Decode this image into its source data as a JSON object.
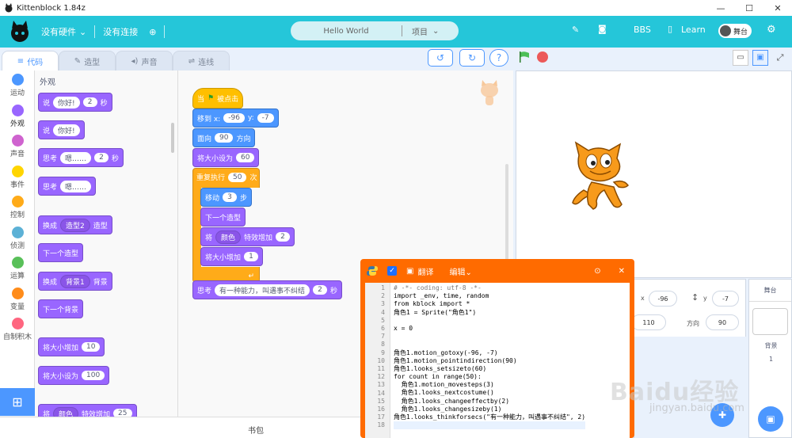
{
  "titlebar": {
    "title": "Kittenblock 1.84z"
  },
  "menubar": {
    "hardware": "没有硬件",
    "connection": "没有连接",
    "project_name": "Hello World",
    "project_menu": "项目",
    "bbs": "BBS",
    "learn": "Learn",
    "stage_toggle": "舞台"
  },
  "tabs": [
    {
      "label": "代码"
    },
    {
      "label": "造型"
    },
    {
      "label": "声音"
    },
    {
      "label": "连线"
    }
  ],
  "categories": [
    {
      "label": "运动",
      "color": "#4c97ff"
    },
    {
      "label": "外观",
      "color": "#9966ff"
    },
    {
      "label": "声音",
      "color": "#cf63cf"
    },
    {
      "label": "事件",
      "color": "#ffd500"
    },
    {
      "label": "控制",
      "color": "#ffab19"
    },
    {
      "label": "侦测",
      "color": "#5cb1d6"
    },
    {
      "label": "运算",
      "color": "#59c059"
    },
    {
      "label": "变量",
      "color": "#ff8c1a"
    },
    {
      "label": "自制积木",
      "color": "#ff6680"
    }
  ],
  "palette": {
    "heading": "外观",
    "say_secs": {
      "verb": "说",
      "text": "你好!",
      "secs": "2",
      "unit": "秒"
    },
    "say": {
      "verb": "说",
      "text": "你好!"
    },
    "think_secs": {
      "verb": "思考",
      "text": "嗯……",
      "secs": "2",
      "unit": "秒"
    },
    "think": {
      "verb": "思考",
      "text": "嗯……"
    },
    "switch_costume": {
      "verb": "换成",
      "value": "造型2",
      "suffix": "造型"
    },
    "next_costume": "下一个造型",
    "switch_backdrop": {
      "verb": "换成",
      "value": "背景1",
      "suffix": "背景"
    },
    "next_backdrop": "下一个背景",
    "change_size": {
      "verb": "将大小增加",
      "value": "10"
    },
    "set_size": {
      "verb": "将大小设为",
      "value": "100"
    },
    "change_effect": {
      "verb": "将",
      "value": "颜色",
      "suffix": "特效增加",
      "num": "25"
    }
  },
  "script": {
    "hat": {
      "prefix": "当",
      "suffix": "被点击"
    },
    "goto": {
      "label": "移到 x:",
      "x": "-96",
      "ylabel": "y:",
      "y": "-7"
    },
    "point": {
      "label": "面向",
      "value": "90",
      "suffix": "方向"
    },
    "setsize": {
      "label": "将大小设为",
      "value": "60"
    },
    "repeat": {
      "label": "重复执行",
      "value": "50",
      "suffix": "次"
    },
    "move": {
      "label": "移动",
      "value": "3",
      "suffix": "步"
    },
    "next_costume": "下一个造型",
    "effect": {
      "label": "将",
      "value": "颜色",
      "suffix": "特效增加",
      "num": "2"
    },
    "changesize": {
      "label": "将大小增加",
      "value": "1"
    },
    "think": {
      "label": "思考",
      "text": "有一种能力，叫遇事不纠结",
      "secs": "2",
      "unit": "秒"
    }
  },
  "editor": {
    "translate": "翻译",
    "edit": "编辑",
    "lines": [
      {
        "n": "1",
        "t": "# -*- coding: utf-8 -*-",
        "c": "cm"
      },
      {
        "n": "2",
        "t": "import _env, time, random",
        "c": ""
      },
      {
        "n": "3",
        "t": "from kblock import *",
        "c": ""
      },
      {
        "n": "4",
        "t": "角色1 = Sprite(\"角色1\")",
        "c": ""
      },
      {
        "n": "5",
        "t": "",
        "c": ""
      },
      {
        "n": "6",
        "t": "x = 0",
        "c": ""
      },
      {
        "n": "7",
        "t": "",
        "c": ""
      },
      {
        "n": "8",
        "t": "",
        "c": ""
      },
      {
        "n": "9",
        "t": "角色1.motion_gotoxy(-96, -7)",
        "c": ""
      },
      {
        "n": "10",
        "t": "角色1.motion_pointindirection(90)",
        "c": ""
      },
      {
        "n": "11",
        "t": "角色1.looks_setsizeto(60)",
        "c": ""
      },
      {
        "n": "12",
        "t": "for count in range(50):",
        "c": ""
      },
      {
        "n": "13",
        "t": "  角色1.motion_movesteps(3)",
        "c": ""
      },
      {
        "n": "14",
        "t": "  角色1.looks_nextcostume()",
        "c": ""
      },
      {
        "n": "15",
        "t": "  角色1.looks_changeeffectby(2)",
        "c": ""
      },
      {
        "n": "16",
        "t": "  角色1.looks_changesizeby(1)",
        "c": ""
      },
      {
        "n": "17",
        "t": "角色1.looks_thinkforsecs(\"有一种能力，叫遇事不纠结\", 2)",
        "c": ""
      },
      {
        "n": "18",
        "t": "",
        "c": ""
      }
    ]
  },
  "sprite_info": {
    "x_label": "x",
    "x": "-96",
    "y_label": "y",
    "y": "-7",
    "size": "110",
    "direction_label": "方向",
    "direction": "90"
  },
  "stage_panel": {
    "title": "舞台",
    "backdrop_label": "背景",
    "backdrop_count": "1"
  },
  "bottombar": {
    "backpack": "书包"
  },
  "watermark": {
    "text": "Baidu经验",
    "url": "jingyan.baidu.com"
  }
}
